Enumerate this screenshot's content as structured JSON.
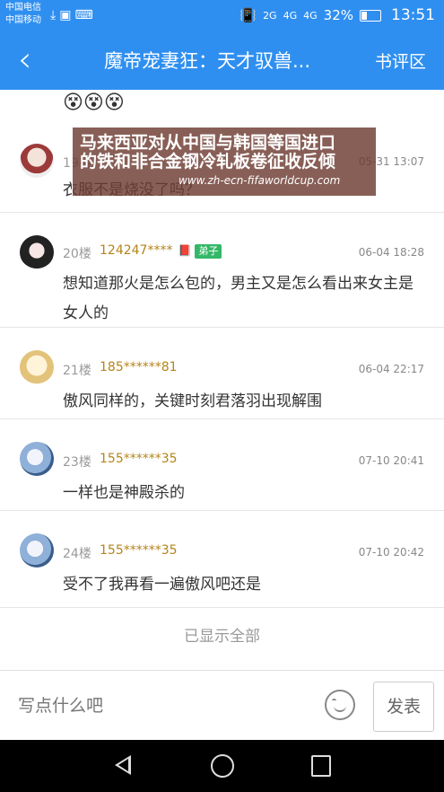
{
  "status_bar": {
    "carrier1": "中国电信",
    "carrier2": "中国移动",
    "net1": "2G",
    "net2": "4G",
    "net3": "4G",
    "battery": "32%",
    "time": "13:51"
  },
  "header": {
    "title": "魔帝宠妻狂：天才驭兽...",
    "review_label": "书评区"
  },
  "comments": [
    {
      "floor": "19楼",
      "user": "",
      "date": "05-31 13:07",
      "text": "衣服不是烧没了吗？"
    },
    {
      "floor": "20楼",
      "user": "124247****",
      "badge": "弟子",
      "date": "06-04 18:28",
      "text": "想知道那火是怎么包的，男主又是怎么看出来女主是女人的"
    },
    {
      "floor": "21楼",
      "user": "185******81",
      "date": "06-04 22:17",
      "text": "傲风同样的，关键时刻君落羽出现解围"
    },
    {
      "floor": "23楼",
      "user": "155******35",
      "date": "07-10 20:41",
      "text": "一样也是神殿杀的"
    },
    {
      "floor": "24楼",
      "user": "155******35",
      "date": "07-10 20:42",
      "text": "受不了我再看一遍傲风吧还是"
    }
  ],
  "show_all": "已显示全部",
  "ad": {
    "line1": "马来西亚对从中国与韩国等国进口",
    "line2": "的铁和非合金钢冷轧板卷征收反倾",
    "url": "www.zh-ecn-fifaworldcup.com"
  },
  "composer": {
    "placeholder": "写点什么吧",
    "send_label": "发表"
  },
  "colors": {
    "accent": "#2f8ff0",
    "username": "#b5841a",
    "badge": "#33b867"
  }
}
